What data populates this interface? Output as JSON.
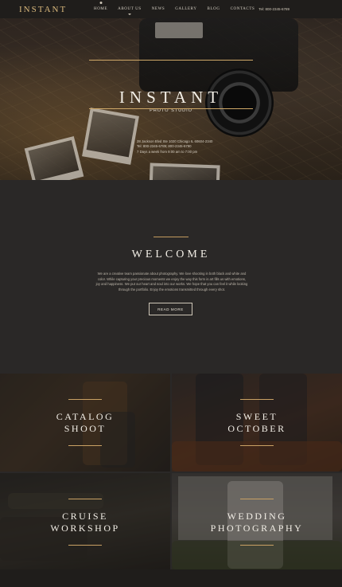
{
  "brand": {
    "logo": "INSTANT"
  },
  "nav": {
    "items": [
      {
        "label": "HOME"
      },
      {
        "label": "ABOUT US"
      },
      {
        "label": "NEWS"
      },
      {
        "label": "GALLERY"
      },
      {
        "label": "BLOG"
      },
      {
        "label": "CONTACTS"
      }
    ],
    "phone": "Tel: 800-2345-6789"
  },
  "hero": {
    "title": "INSTANT",
    "subtitle": "PHOTO STUDIO",
    "info": [
      "28 Jackson Blvd Ste 1020 Chicago IL 60604-2340",
      "Tel: 800-2345-6789; 800-2345-6790",
      "7 Days a week from 9:00 am to 7:00 pm"
    ]
  },
  "welcome": {
    "title": "WELCOME",
    "text": "We are a creative team passionate about photography. We love shooting in both black and white and color. While capturing your precious moments we enjoy the way this form is art fills us with emotions, joy and happiness. We put our heart and soul into our works. We hope that you can feel it while looking through the portfolio. Enjoy the emotions transmitted through every shot.",
    "button": "READ MORE"
  },
  "gallery": {
    "tiles": [
      {
        "label_line1": "CATALOG",
        "label_line2": "SHOOT"
      },
      {
        "label_line1": "SWEET",
        "label_line2": "OCTOBER"
      },
      {
        "label_line1": "CRUISE",
        "label_line2": "WORKSHOP"
      },
      {
        "label_line1": "WEDDING",
        "label_line2": "PHOTOGRAPHY"
      }
    ]
  },
  "colors": {
    "accent": "#cfa868",
    "background": "#2a2827",
    "nav_bg": "#1f1d1b"
  }
}
